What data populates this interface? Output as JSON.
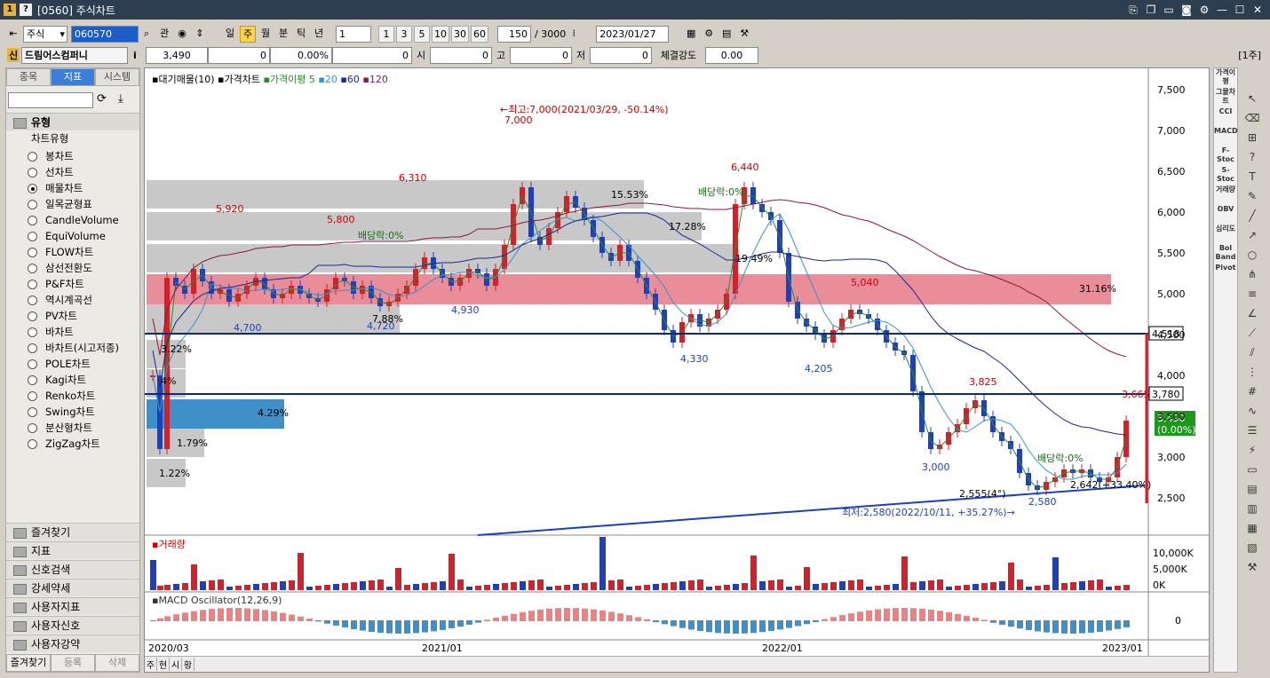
{
  "window": {
    "title": "[0560] 주식차트"
  },
  "toolbar": {
    "market": "주식",
    "code": "060570",
    "view_label": "관",
    "periods": [
      "일",
      "주",
      "월",
      "분",
      "틱",
      "년"
    ],
    "selected_period": "주",
    "unit": "1",
    "quick": [
      "1",
      "3",
      "5",
      "10",
      "30",
      "60"
    ],
    "count": "150",
    "total": "/ 3000",
    "date": "2023/01/27"
  },
  "quote": {
    "name": "드림어스컴퍼니",
    "price": "3,490",
    "change": "0",
    "rate": "0.00%",
    "volume": "0",
    "open_label": "시",
    "open": "0",
    "high_label": "고",
    "high": "0",
    "low_label": "저",
    "low": "0",
    "strength_label": "체결강도",
    "strength": "0.00",
    "unit_label": "[1주]"
  },
  "sidebar": {
    "tabs": [
      "종목",
      "지표",
      "시스템"
    ],
    "active_tab": "지표",
    "group_title": "유형",
    "sub": "차트유형",
    "items": [
      "봉차트",
      "선차트",
      "매물차트",
      "일목균형표",
      "CandleVolume",
      "EquiVolume",
      "FLOW차트",
      "삼선전환도",
      "P&F차트",
      "역시계곡선",
      "PV차트",
      "바차트",
      "바차트(시고저종)",
      "POLE차트",
      "Kagi차트",
      "Renko차트",
      "Swing차트",
      "분산형차트",
      "ZigZag차트"
    ],
    "selected": "매물차트",
    "groups": [
      "즐겨찾기",
      "지표",
      "신호검색",
      "강세약세",
      "사용자지표",
      "사용자신호",
      "사용자강약"
    ],
    "footer": [
      "즐겨찾기",
      "등록",
      "삭제"
    ]
  },
  "legend": {
    "a": "대기매물(10)",
    "b": "가격차트",
    "c": "가격이평",
    "ma": [
      "5",
      "20",
      "60",
      "120"
    ]
  },
  "price_axis": [
    "7,500",
    "7,000",
    "6,500",
    "6,000",
    "5,500",
    "5,000",
    "4,500",
    "4,000",
    "3,500",
    "3,000",
    "2,500"
  ],
  "annotations": {
    "high": "←최고:7,000(2021/03/29, -50.14%)",
    "low": "최저:2,580(2022/10/11, +35.27%)→",
    "div1": "배당락:0%",
    "div2": "배당락:0%",
    "div3": "배당락:0%",
    "last": "2,642(+33.40%)",
    "last2": "2,555(4°)",
    "h7000": "7,000",
    "h6440": "6,440",
    "h6310": "6,310",
    "h5920": "5,920",
    "h5800": "5,800",
    "h5040": "5,040",
    "h3825": "3,825",
    "h3665": "3,665",
    "l4700": "4,700",
    "l4720": "4,720",
    "l4930": "4,930",
    "l4330": "4,330",
    "l4205": "4,205",
    "l3000": "3,000",
    "l2580": "2,580"
  },
  "bars": [
    "15.53%",
    "17.28%",
    "19.49%",
    "31.16%",
    "7.88%",
    "3.22%",
    "4.29%",
    "1.79%",
    "1.22%",
    "4%"
  ],
  "hlines": {
    "a": "4,518",
    "b": "3,780",
    "cur": "3,490",
    "cur_pct": "(0.00%)"
  },
  "volume": {
    "title": "거래량",
    "axis": [
      "10,000K",
      "5,000K",
      "0K"
    ]
  },
  "macd": {
    "title": "MACD Oscillator(12,26,9)",
    "axis": "0"
  },
  "xaxis": [
    "2020/03",
    "2021/01",
    "2022/01",
    "2023/01"
  ],
  "bottom": [
    "주",
    "현",
    "시",
    "황"
  ],
  "rtool": [
    "가격이평",
    "그물차트",
    "CCI",
    "MACD",
    "F-Stoc",
    "S-Stoc",
    "거래량",
    "OBV",
    "심리도",
    "Bol Band",
    "Pivot"
  ],
  "colors": {
    "up": "#d4202a",
    "down": "#1f3fbf",
    "band": "#c8c8c8",
    "pink": "#e98d99",
    "blue": "#3f8fc9"
  }
}
